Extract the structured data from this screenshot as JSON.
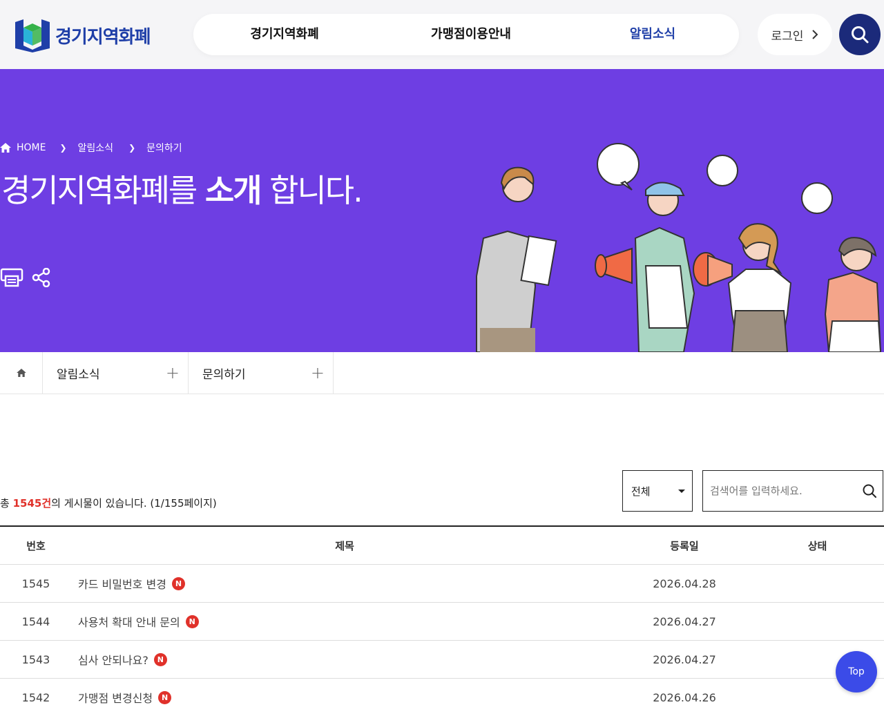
{
  "header": {
    "logo_text": "경기지역화폐",
    "nav": [
      {
        "label": "경기지역화폐"
      },
      {
        "label": "가맹점이용안내"
      },
      {
        "label": "알림소식"
      }
    ],
    "login_label": "로그인"
  },
  "hero": {
    "breadcrumb": {
      "home": "HOME",
      "level1": "알림소식",
      "level2": "문의하기"
    },
    "title_pre": "경기지역화폐를 ",
    "title_bold": "소개",
    "title_post": " 합니다."
  },
  "subnav": {
    "dropdown1": "알림소식",
    "dropdown2": "문의하기"
  },
  "board": {
    "total_pre": "총 ",
    "total_count": "1545건",
    "total_post": "의 게시물이 있습니다. (1/155페이지)",
    "filter_selected": "전체",
    "search_placeholder": "검색어를 입력하세요.",
    "columns": {
      "no": "번호",
      "title": "제목",
      "date": "등록일",
      "state": "상태"
    },
    "new_badge": "N",
    "rows": [
      {
        "no": "1545",
        "title": "카드 비밀번호 변경",
        "date": "2026.04.28",
        "state": ""
      },
      {
        "no": "1544",
        "title": "사용처 확대 안내 문의",
        "date": "2026.04.27",
        "state": ""
      },
      {
        "no": "1543",
        "title": "심사 안되나요?",
        "date": "2026.04.27",
        "state": ""
      },
      {
        "no": "1542",
        "title": "가맹점 변경신청",
        "date": "2026.04.26",
        "state": ""
      }
    ]
  },
  "top_button": "Top",
  "colors": {
    "hero_bg": "#6e3ee3",
    "brand_blue": "#1f3fa8",
    "accent_red": "#e0312a",
    "top_btn": "#3b4be8"
  }
}
